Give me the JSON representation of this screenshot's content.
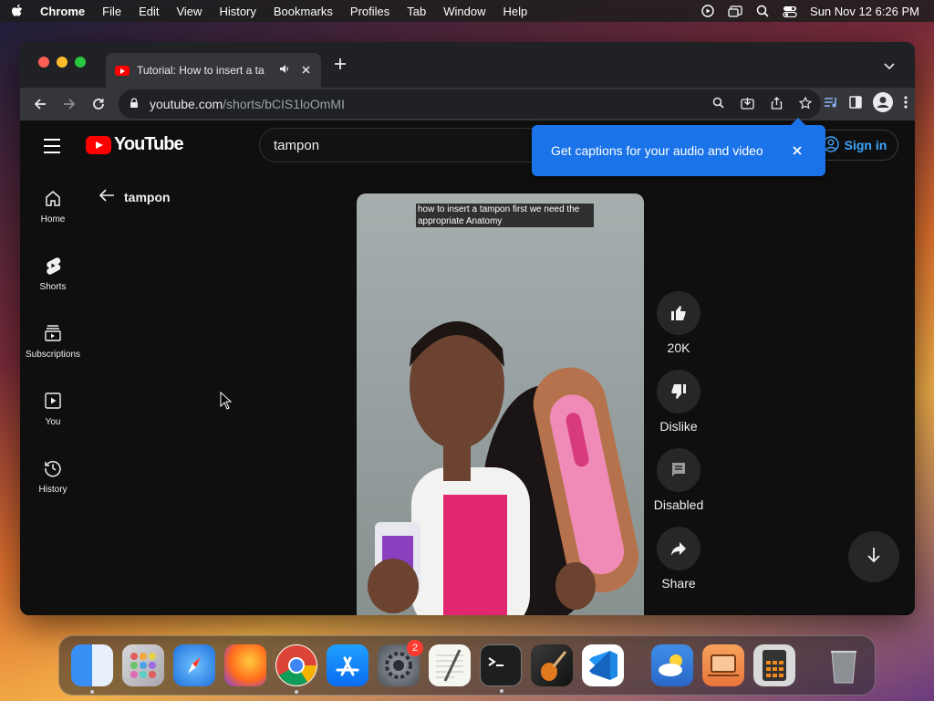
{
  "menubar": {
    "app": "Chrome",
    "items": [
      "File",
      "Edit",
      "View",
      "History",
      "Bookmarks",
      "Profiles",
      "Tab",
      "Window",
      "Help"
    ],
    "datetime": "Sun Nov 12  6:26 PM"
  },
  "browser": {
    "tab_title": "Tutorial: How to insert a ta",
    "url_host": "youtube.com",
    "url_path": "/shorts/bCIS1loOmMI"
  },
  "youtube": {
    "logo_text": "YouTube",
    "search_value": "tampon",
    "signin_label": "Sign in",
    "tooltip_text": "Get captions for your audio and video",
    "guide": [
      {
        "label": "Home",
        "icon": "home-icon"
      },
      {
        "label": "Shorts",
        "icon": "shorts-icon"
      },
      {
        "label": "Subscriptions",
        "icon": "subscriptions-icon"
      },
      {
        "label": "You",
        "icon": "you-icon"
      },
      {
        "label": "History",
        "icon": "history-icon"
      }
    ],
    "back_title": "tampon",
    "caption": "how to insert a tampon first we need the appropriate Anatomy",
    "actions": {
      "like": "20K",
      "dislike": "Dislike",
      "comments": "Disabled",
      "share": "Share"
    }
  },
  "dock": {
    "apps": [
      "Finder",
      "Launchpad",
      "Safari",
      "Firefox",
      "Chrome",
      "App Store",
      "System Settings",
      "TextEdit",
      "Terminal",
      "GarageBand",
      "Visual Studio Code",
      "Weather",
      "Screen Sharing",
      "Calculator",
      "Trash"
    ],
    "settings_badge": "2"
  },
  "colors": {
    "yt_red": "#ff0000",
    "tooltip_blue": "#1a73e8",
    "link_blue": "#3ea6ff"
  }
}
